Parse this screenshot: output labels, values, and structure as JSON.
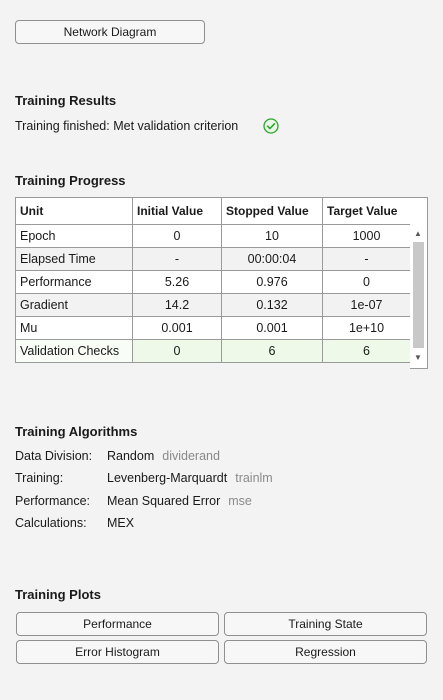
{
  "top": {
    "network_diagram_label": "Network Diagram"
  },
  "results": {
    "title": "Training Results",
    "status": "Training finished: Met validation criterion"
  },
  "progress": {
    "title": "Training Progress",
    "columns": [
      "Unit",
      "Initial Value",
      "Stopped Value",
      "Target Value"
    ],
    "rows": [
      {
        "unit": "Epoch",
        "initial": "0",
        "stopped": "10",
        "target": "1000"
      },
      {
        "unit": "Elapsed Time",
        "initial": "-",
        "stopped": "00:00:04",
        "target": "-"
      },
      {
        "unit": "Performance",
        "initial": "5.26",
        "stopped": "0.976",
        "target": "0"
      },
      {
        "unit": "Gradient",
        "initial": "14.2",
        "stopped": "0.132",
        "target": "1e-07"
      },
      {
        "unit": "Mu",
        "initial": "0.001",
        "stopped": "0.001",
        "target": "1e+10"
      },
      {
        "unit": "Validation Checks",
        "initial": "0",
        "stopped": "6",
        "target": "6"
      }
    ]
  },
  "algorithms": {
    "title": "Training Algorithms",
    "items": [
      {
        "label": "Data Division:",
        "value": "Random",
        "fn": "dividerand"
      },
      {
        "label": "Training:",
        "value": "Levenberg-Marquardt",
        "fn": "trainlm"
      },
      {
        "label": "Performance:",
        "value": "Mean Squared Error",
        "fn": "mse"
      },
      {
        "label": "Calculations:",
        "value": "MEX",
        "fn": ""
      }
    ]
  },
  "plots": {
    "title": "Training Plots",
    "buttons": [
      "Performance",
      "Training State",
      "Error Histogram",
      "Regression"
    ]
  },
  "colors": {
    "success": "#2fa52f",
    "valid_row": "#eef9ea"
  },
  "icons": {
    "status": "check-circle-icon",
    "scroll_up": "scroll-up-arrow-icon",
    "scroll_down": "scroll-down-arrow-icon"
  }
}
